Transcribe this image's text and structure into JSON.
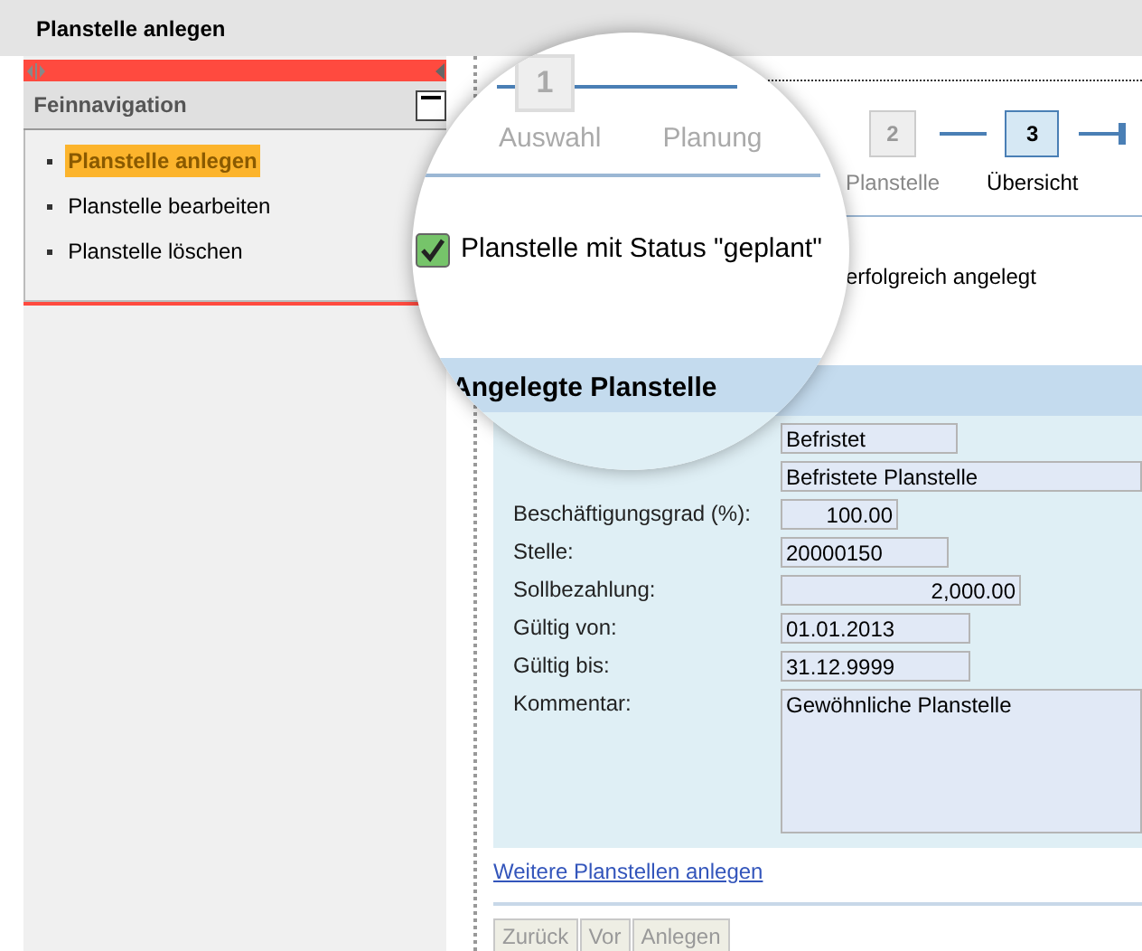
{
  "window": {
    "title": "Planstelle anlegen"
  },
  "sidebar": {
    "title": "Feinnavigation",
    "items": [
      {
        "label": "Planstelle anlegen",
        "selected": true
      },
      {
        "label": "Planstelle bearbeiten",
        "selected": false
      },
      {
        "label": "Planstelle löschen",
        "selected": false
      }
    ]
  },
  "magnifier": {
    "step_number": "1",
    "step_labels": [
      "Auswahl",
      "Planung"
    ],
    "checkbox": {
      "label": "Planstelle mit Status \"geplant\"",
      "checked": true
    },
    "panel_title": "Angelegte Planstelle"
  },
  "wizard": {
    "steps": [
      {
        "number": "2",
        "label": "Planstelle",
        "selected": false
      },
      {
        "number": "3",
        "label": "Übersicht",
        "selected": true
      }
    ]
  },
  "message": "erfolgreich angelegt",
  "form": {
    "fields": [
      {
        "kind": "text",
        "value": "Befristet"
      },
      {
        "kind": "text",
        "value": "Befristete Planstelle"
      },
      {
        "kind": "number",
        "label": "Beschäftigungsgrad (%):",
        "value": "100.00"
      },
      {
        "kind": "text",
        "label": "Stelle:",
        "value": "20000150"
      },
      {
        "kind": "number",
        "label": "Sollbezahlung:",
        "value": "2,000.00"
      },
      {
        "kind": "text",
        "label": "Gültig von:",
        "value": "01.01.2013"
      },
      {
        "kind": "text",
        "label": "Gültig bis:",
        "value": "31.12.9999"
      },
      {
        "kind": "multiline",
        "label": "Kommentar:",
        "value": "Gewöhnliche Planstelle"
      }
    ]
  },
  "link": "Weitere Planstellen anlegen",
  "buttons": [
    {
      "label": "Zurück",
      "disabled": true
    },
    {
      "label": "Vor",
      "disabled": true
    },
    {
      "label": "Anlegen",
      "disabled": true
    }
  ]
}
